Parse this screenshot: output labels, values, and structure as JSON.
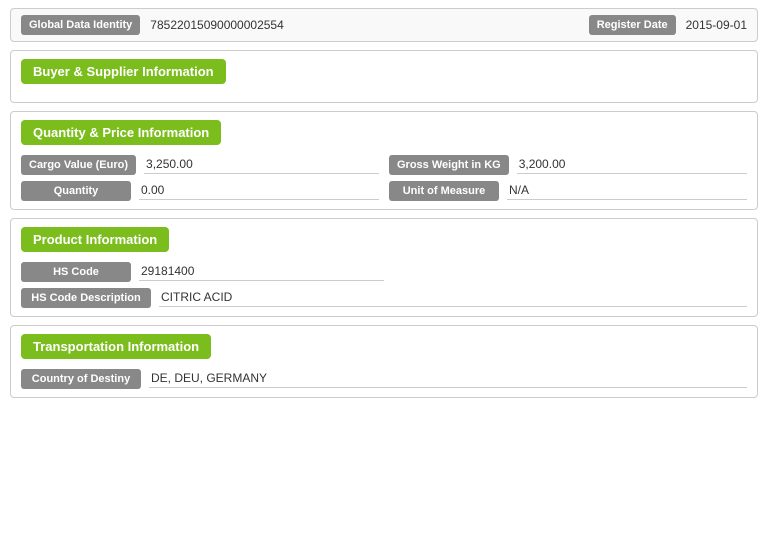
{
  "header": {
    "global_data_label": "Global Data Identity",
    "global_data_value": "78522015090000002554",
    "register_date_label": "Register Date",
    "register_date_value": "2015-09-01"
  },
  "sections": {
    "buyer_supplier": {
      "title": "Buyer & Supplier Information"
    },
    "quantity_price": {
      "title": "Quantity & Price Information",
      "fields": [
        {
          "label": "Cargo Value (Euro)",
          "value": "3,250.00"
        },
        {
          "label": "Gross Weight in KG",
          "value": "3,200.00"
        },
        {
          "label": "Quantity",
          "value": "0.00"
        },
        {
          "label": "Unit of Measure",
          "value": "N/A"
        }
      ]
    },
    "product": {
      "title": "Product Information",
      "fields": [
        {
          "label": "HS Code",
          "value": "29181400"
        },
        {
          "label": "HS Code Description",
          "value": "CITRIC ACID"
        }
      ]
    },
    "transportation": {
      "title": "Transportation Information",
      "fields": [
        {
          "label": "Country of Destiny",
          "value": "DE, DEU, GERMANY"
        }
      ]
    }
  }
}
